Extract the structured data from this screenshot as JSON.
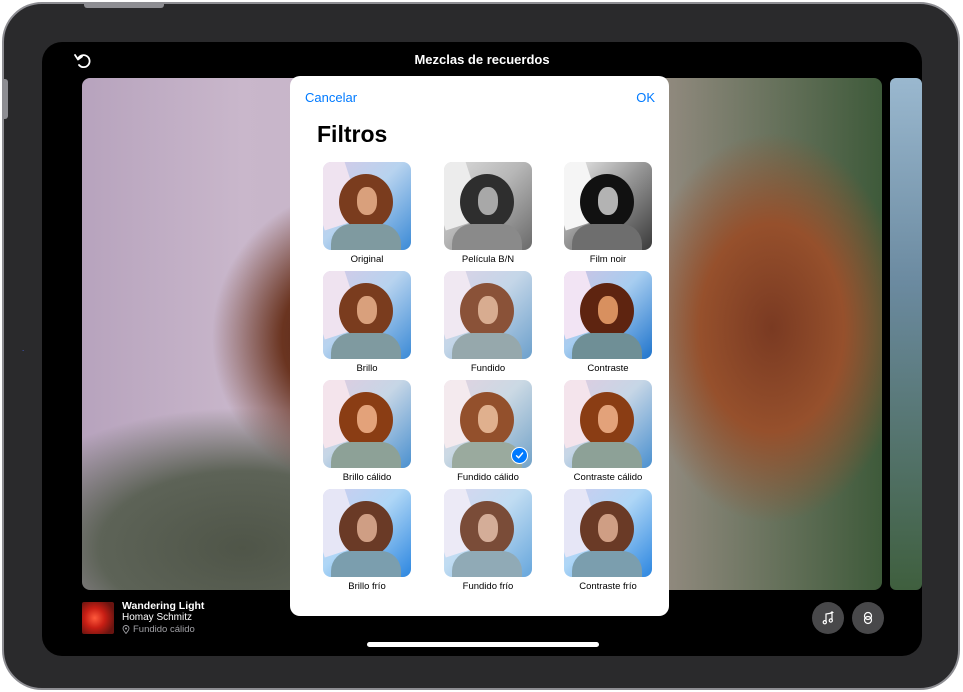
{
  "header": {
    "title": "Mezclas de recuerdos"
  },
  "song": {
    "title": "Wandering Light",
    "artist": "Homay Schmitz",
    "filter": "Fundido cálido"
  },
  "sheet": {
    "cancel_label": "Cancelar",
    "ok_label": "OK",
    "title": "Filtros",
    "filters": [
      {
        "label": "Original",
        "style": "color"
      },
      {
        "label": "Película B/N",
        "style": "mono"
      },
      {
        "label": "Film noir",
        "style": "noir"
      },
      {
        "label": "Brillo",
        "style": "color"
      },
      {
        "label": "Fundido",
        "style": "faded"
      },
      {
        "label": "Contraste",
        "style": "contrast"
      },
      {
        "label": "Brillo cálido",
        "style": "warm"
      },
      {
        "label": "Fundido cálido",
        "style": "warmfaded",
        "selected": true
      },
      {
        "label": "Contraste cálido",
        "style": "warm"
      },
      {
        "label": "Brillo frío",
        "style": "cool"
      },
      {
        "label": "Fundido frío",
        "style": "coolfaded"
      },
      {
        "label": "Contraste frío",
        "style": "cool"
      }
    ]
  },
  "colors": {
    "accent": "#007aff",
    "sheet_bg": "#ffffff",
    "frame": "#2a2a2c"
  },
  "icons": [
    "undo-icon",
    "music-note-icon",
    "filter-icon",
    "location-pin-icon",
    "checkmark-icon"
  ]
}
